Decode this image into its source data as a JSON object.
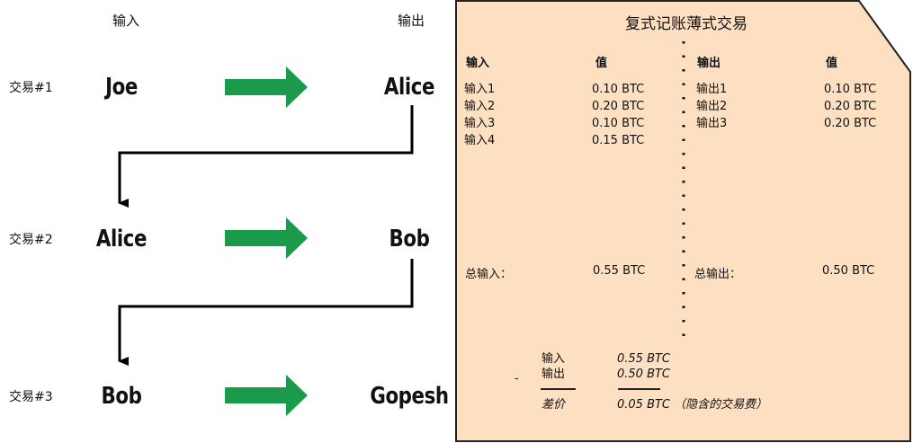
{
  "left": {
    "input_header": "输入",
    "output_header": "输出",
    "transactions": [
      {
        "label": "交易#1",
        "input": "Joe",
        "output": "Alice"
      },
      {
        "label": "交易#2",
        "input": "Alice",
        "output": "Bob"
      },
      {
        "label": "交易#3",
        "input": "Bob",
        "output": "Gopesh"
      }
    ],
    "arrow_color": "#1a9a4a"
  },
  "ledger": {
    "title": "复式记账薄式交易",
    "bg_color": "#fde0c2",
    "inputs_header": "输入",
    "inputs_value_header": "值",
    "outputs_header": "输出",
    "outputs_value_header": "值",
    "inputs": [
      {
        "name": "输入1",
        "value": "0.10 BTC"
      },
      {
        "name": "输入2",
        "value": "0.20 BTC"
      },
      {
        "name": "输入3",
        "value": "0.10 BTC"
      },
      {
        "name": "输入4",
        "value": "0.15 BTC"
      }
    ],
    "outputs": [
      {
        "name": "输出1",
        "value": "0.10 BTC"
      },
      {
        "name": "输出2",
        "value": "0.20 BTC"
      },
      {
        "name": "输出3",
        "value": "0.20 BTC"
      }
    ],
    "total_input_label": "总输入：",
    "total_input_value": "0.55 BTC",
    "total_output_label": "总输出：",
    "total_output_value": "0.50 BTC",
    "calc": {
      "minus": "-",
      "input_label": "输入",
      "input_value": "0.55 BTC",
      "output_label": "输出",
      "output_value": "0.50 BTC",
      "diff_label": "差价",
      "diff_value": "0.05 BTC",
      "diff_note": "（隐含的交易费）"
    }
  }
}
